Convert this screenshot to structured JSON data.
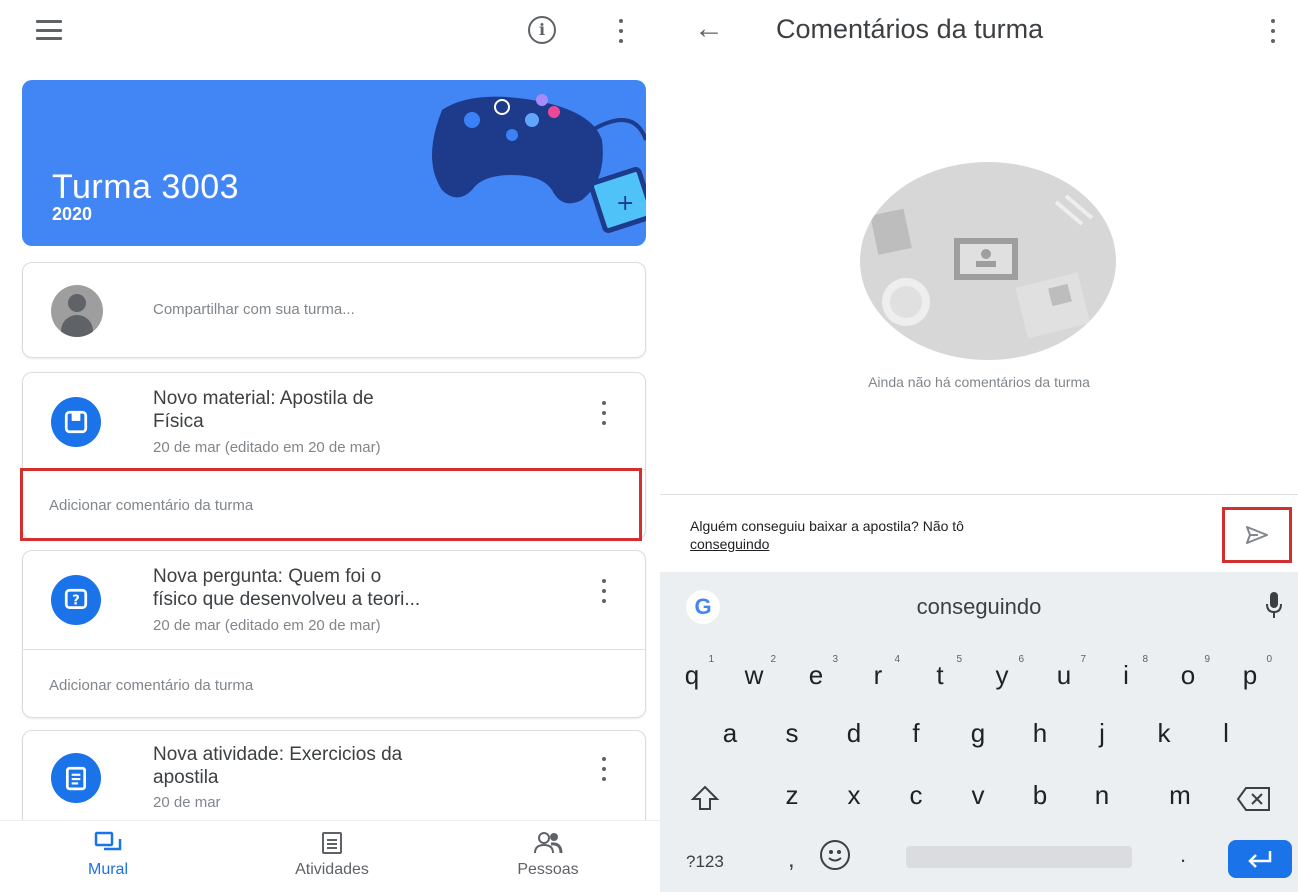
{
  "left": {
    "class_name": "Turma 3003",
    "class_year": "2020",
    "share_placeholder": "Compartilhar com sua turma...",
    "posts": [
      {
        "title_line1": "Novo material: Apostila de",
        "title_line2": "Física",
        "date": "20 de mar (editado em 20 de mar)",
        "comment_label": "Adicionar comentário da turma",
        "icon": "material-icon"
      },
      {
        "title_line1": "Nova pergunta: Quem foi o",
        "title_line2": "físico que desenvolveu a teori...",
        "date": "20 de mar (editado em 20 de mar)",
        "comment_label": "Adicionar comentário da turma",
        "icon": "question-icon"
      },
      {
        "title_line1": "Nova atividade: Exercicios da",
        "title_line2": "apostila",
        "date": "20 de mar",
        "icon": "assignment-icon"
      }
    ],
    "bottom_nav": [
      {
        "label": "Mural",
        "icon": "stream-icon",
        "active": true
      },
      {
        "label": "Atividades",
        "icon": "classwork-icon",
        "active": false
      },
      {
        "label": "Pessoas",
        "icon": "people-icon",
        "active": false
      }
    ]
  },
  "right": {
    "title": "Comentários da turma",
    "empty_message": "Ainda não há comentários da turma",
    "input_value_part1": "Alguém conseguiu baixar a apostila? Não tô",
    "input_value_part2": "conseguindo",
    "keyboard": {
      "suggestion": "conseguindo",
      "row1": [
        "q",
        "w",
        "e",
        "r",
        "t",
        "y",
        "u",
        "i",
        "o",
        "p"
      ],
      "row1_hints": [
        "1",
        "2",
        "3",
        "4",
        "5",
        "6",
        "7",
        "8",
        "9",
        "0"
      ],
      "row2": [
        "a",
        "s",
        "d",
        "f",
        "g",
        "h",
        "j",
        "k",
        "l"
      ],
      "row3": [
        "z",
        "x",
        "c",
        "v",
        "b",
        "n",
        "m"
      ],
      "symbols_key": "?123",
      "comma_key": ",",
      "period_key": "."
    }
  },
  "colors": {
    "accent": "#1a73e8",
    "banner": "#4285f4",
    "highlight": "#d32f2f"
  }
}
